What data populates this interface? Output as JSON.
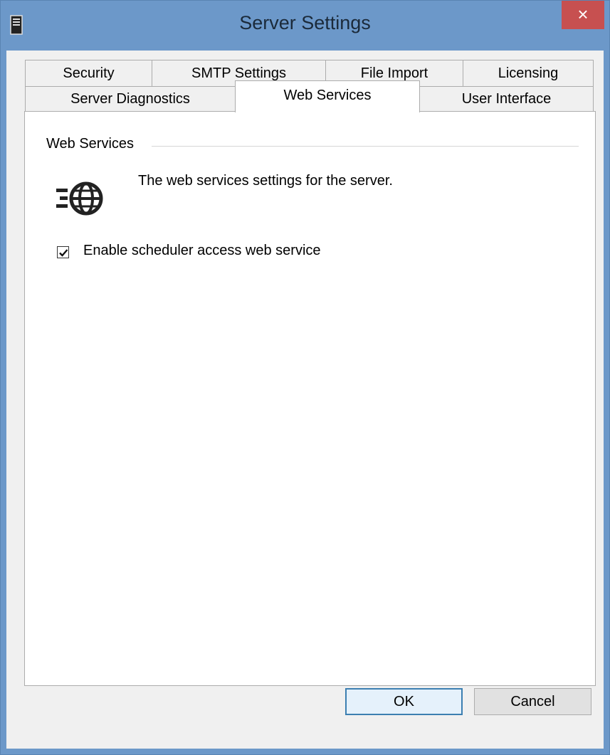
{
  "window": {
    "title": "Server Settings",
    "close_glyph": "×",
    "app_icon": "server-icon"
  },
  "tabs": {
    "row_top": [
      {
        "label": "Security"
      },
      {
        "label": "SMTP Settings"
      },
      {
        "label": "File Import"
      },
      {
        "label": "Licensing"
      }
    ],
    "row_bottom": [
      {
        "label": "Server Diagnostics"
      },
      {
        "label": "Web Services",
        "active": true
      },
      {
        "label": "User Interface"
      }
    ]
  },
  "panel": {
    "group_title": "Web Services",
    "icon": "web-services-globe-icon",
    "description": "The web services settings for the server.",
    "checkbox": {
      "label": "Enable scheduler access web service",
      "checked": true
    }
  },
  "buttons": {
    "ok": "OK",
    "cancel": "Cancel"
  },
  "colors": {
    "title_bar": "#6c98c9",
    "close_button": "#c75050",
    "ok_button_border": "#3c7fb1"
  }
}
